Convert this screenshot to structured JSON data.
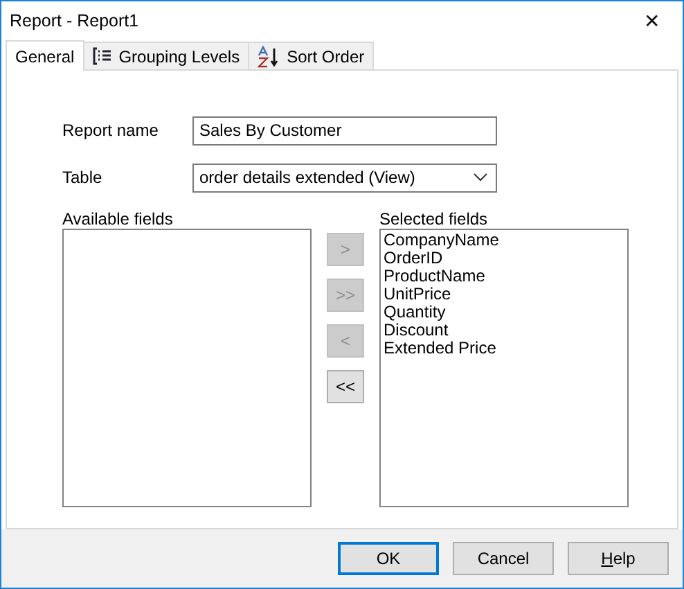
{
  "window": {
    "title": "Report - Report1",
    "close": "✕"
  },
  "tabs": [
    {
      "label": "General",
      "selected": true,
      "kind": "plain"
    },
    {
      "label": "Grouping Levels",
      "selected": false,
      "kind": "grouping"
    },
    {
      "label": "Sort Order",
      "selected": false,
      "kind": "sorting"
    }
  ],
  "report_name": {
    "label": "Report name",
    "value": "Sales By Customer"
  },
  "table": {
    "label": "Table",
    "value": "order details extended (View)"
  },
  "available_fields": {
    "label": "Available fields"
  },
  "move_buttons": [
    {
      "label": ">",
      "disabled": true
    },
    {
      "label": ">>",
      "disabled": true
    },
    {
      "label": "<",
      "disabled": true
    },
    {
      "label": "<<",
      "disabled": false
    }
  ],
  "selected_fields": {
    "label": "Selected fields",
    "items": [
      "CompanyName",
      "OrderID",
      "ProductName",
      "UnitPrice",
      "Quantity",
      "Discount",
      "Extended Price"
    ]
  },
  "buttons": [
    {
      "label": "OK",
      "default": true,
      "underline_first": false
    },
    {
      "label": "Cancel",
      "default": false,
      "underline_first": false
    },
    {
      "label": "Help",
      "default": false,
      "underline_first": true
    }
  ]
}
